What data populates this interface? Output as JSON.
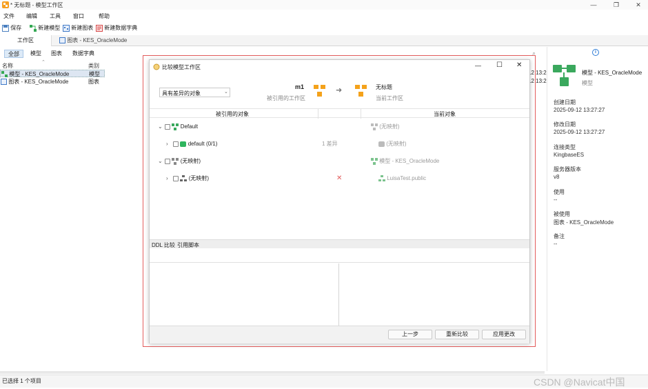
{
  "window": {
    "title": "* 无标题 - 模型工作区",
    "controls": [
      "—",
      "❐",
      "✕"
    ]
  },
  "menu": [
    "文件",
    "编辑",
    "工具",
    "窗口",
    "帮助"
  ],
  "toolbar": {
    "save": "保存",
    "new_model": "新建模型",
    "new_chart": "新建图表",
    "new_dictionary": "新建数据字典"
  },
  "tabs": {
    "workspace": "工作区",
    "chart": "图表 - KES_OracleMode"
  },
  "filter_tabs": [
    "全部",
    "模型",
    "图表",
    "数据字典"
  ],
  "list": {
    "col_name": "名称",
    "col_type": "类别",
    "rows": [
      {
        "name": "模型 - KES_OracleMode",
        "type": "模型",
        "time": "12 13:2"
      },
      {
        "name": "图表 - KES_OracleMode",
        "type": "图表",
        "time": "12 13:2"
      }
    ]
  },
  "status": {
    "text": "已选择 1 个项目",
    "watermark": "CSDN @Navicat中国"
  },
  "right_panel": {
    "title": "模型 - KES_OracleMode",
    "subtitle": "模型",
    "fields": [
      {
        "label": "创建日期",
        "value": "2025-09-12 13:27:27"
      },
      {
        "label": "修改日期",
        "value": "2025-09-12 13:27:27"
      },
      {
        "label": "连接类型",
        "value": "KingbaseES"
      },
      {
        "label": "服务器版本",
        "value": "v8"
      },
      {
        "label": "使用",
        "value": "--"
      },
      {
        "label": "被使用",
        "value": "图表 - KES_OracleMode"
      },
      {
        "label": "备注",
        "value": "--"
      }
    ]
  },
  "dialog": {
    "title": "比较模型工作区",
    "controls": [
      "—",
      "☐",
      "✕"
    ],
    "filter": "具有差异的对象",
    "source": {
      "name": "m1",
      "desc": "被引用的工作区"
    },
    "target": {
      "name": "无标题",
      "desc": "当前工作区"
    },
    "col_source": "被引用的对象",
    "col_target": "当前对象",
    "tree": [
      {
        "label": "Default",
        "diff": "",
        "target": "(无映射)"
      },
      {
        "label": "default (0/1)",
        "diff": "1 差异",
        "target": "(无映射)"
      },
      {
        "label": "(无映射)",
        "diff": "",
        "target": "模型 - KES_OracleMode"
      },
      {
        "label": "(无映射)",
        "diff": "✕",
        "target": "LuisaTest.public"
      }
    ],
    "lower_tabs": [
      "DDL 比较",
      "引用脚本"
    ],
    "buttons": {
      "prev": "上一步",
      "recompare": "重新比较",
      "apply": "应用更改"
    }
  }
}
